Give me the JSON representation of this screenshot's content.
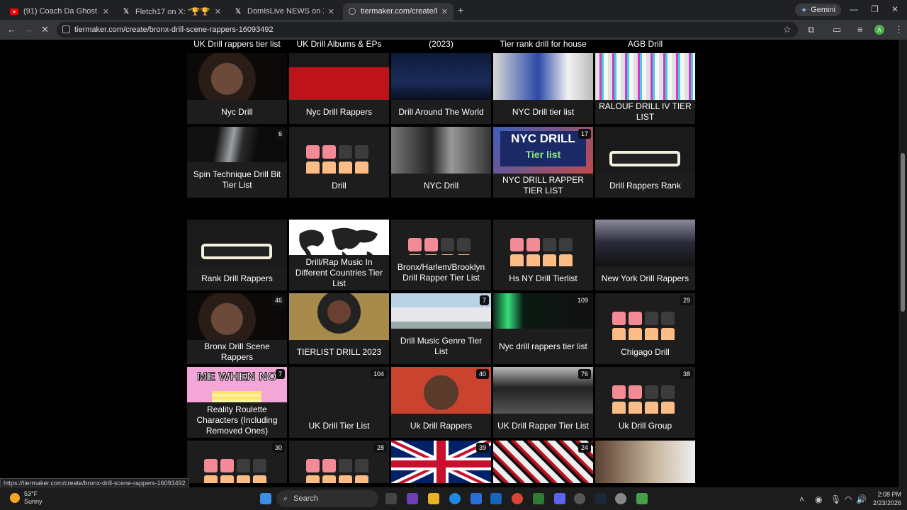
{
  "browser": {
    "tabs": [
      {
        "title": "(91) Coach Da Ghost - Hitlist Fr",
        "favicon": "youtube-icon"
      },
      {
        "title": "Fletch17 on X: \"🏆🏆🏆🏆🏆 I g",
        "favicon": "x-icon"
      },
      {
        "title": "DomIsLive NEWS on X: \"Philly I",
        "favicon": "x-icon"
      },
      {
        "title": "tiermaker.com/create/bronx-d",
        "favicon": "tiermaker-icon"
      }
    ],
    "gemini_label": "Gemini",
    "url": "tiermaker.com/create/bronx-drill-scene-rappers-16093492",
    "status_url": "https://tiermaker.com/create/bronx-drill-scene-rappers-16093492",
    "avatar_letter": "A"
  },
  "top_row_partial": [
    "UK Drill rappers tier list",
    "UK Drill Albums & EPs",
    "(2023)",
    "Tier rank drill for house",
    "AGB Drill"
  ],
  "groups": [
    [
      {
        "title": "Nyc Drill",
        "thumb": "portrait-dark"
      },
      {
        "title": "Nyc Drill Rappers",
        "thumb": "red-car"
      },
      {
        "title": "Drill Around The World",
        "thumb": "crowd-blue"
      },
      {
        "title": "NYC Drill tier list",
        "thumb": "kids"
      },
      {
        "title": "RALOUF DRILL IV TIER LIST",
        "thumb": "glitch"
      }
    ],
    [
      {
        "title": "Spin Technique Drill Bit Tier List",
        "badge": "6",
        "thumb": "drillbit"
      },
      {
        "title": "Drill",
        "thumb": "tiergrid"
      },
      {
        "title": "NYC Drill",
        "thumb": "bw-rappers"
      },
      {
        "title": "NYC DRILL RAPPER TIER LIST",
        "badge": "17",
        "thumb": "nyc-drill-banner",
        "thumb_text": "NYC DRILL Tier list"
      },
      {
        "title": "Drill Rappers Rank",
        "thumb": "glasses"
      }
    ],
    [
      {
        "title": "Rank Drill Rappers",
        "thumb": "glasses"
      },
      {
        "title": "Drill/Rap Music In Different Countries Tier List",
        "thumb": "worldmap"
      },
      {
        "title": "Bronx/Harlem/Brooklyn Drill Rapper Tier List",
        "thumb": "tiergrid"
      },
      {
        "title": "Hs NY Drill Tierlist",
        "thumb": "tiergrid"
      },
      {
        "title": "New York Drill Rappers",
        "thumb": "street-group"
      }
    ],
    [
      {
        "title": "Bronx Drill Scene Rappers",
        "badge": "46",
        "thumb": "portrait-dark"
      },
      {
        "title": "TIERLIST DRILL 2023",
        "thumb": "dreads"
      },
      {
        "title": "Drill Music Genre Tier List",
        "badge": "7",
        "thumb": "house"
      },
      {
        "title": "Nyc drill rappers tier list",
        "badge": "109",
        "thumb": "green-light"
      },
      {
        "title": "Chigago Drill",
        "badge": "29",
        "thumb": "tiergrid"
      }
    ],
    [
      {
        "title": "Reality Roulette Characters (Including Removed Ones)",
        "badge": "7",
        "thumb": "meme",
        "thumb_text": "ME WHEN NO"
      },
      {
        "title": "UK Drill Tier List",
        "badge": "104",
        "thumb": "blank"
      },
      {
        "title": "Uk Drill Rappers",
        "badge": "40",
        "thumb": "man-red"
      },
      {
        "title": "UK Drill Rapper Tier List",
        "badge": "76",
        "thumb": "bw-group"
      },
      {
        "title": "Uk Drill Group",
        "badge": "38",
        "thumb": "tiergrid"
      }
    ],
    [
      {
        "title": "",
        "badge": "30",
        "thumb": "tiergrid"
      },
      {
        "title": "",
        "badge": "28",
        "thumb": "tiergrid"
      },
      {
        "title": "",
        "badge": "39",
        "thumb": "union-jack"
      },
      {
        "title": "",
        "badge": "24",
        "thumb": "graffiti"
      },
      {
        "title": "",
        "thumb": "room"
      }
    ]
  ],
  "taskbar": {
    "temp": "53°F",
    "weather": "Sunny",
    "search_placeholder": "Search",
    "time": "2:08 PM",
    "date": "2/23/2026"
  }
}
